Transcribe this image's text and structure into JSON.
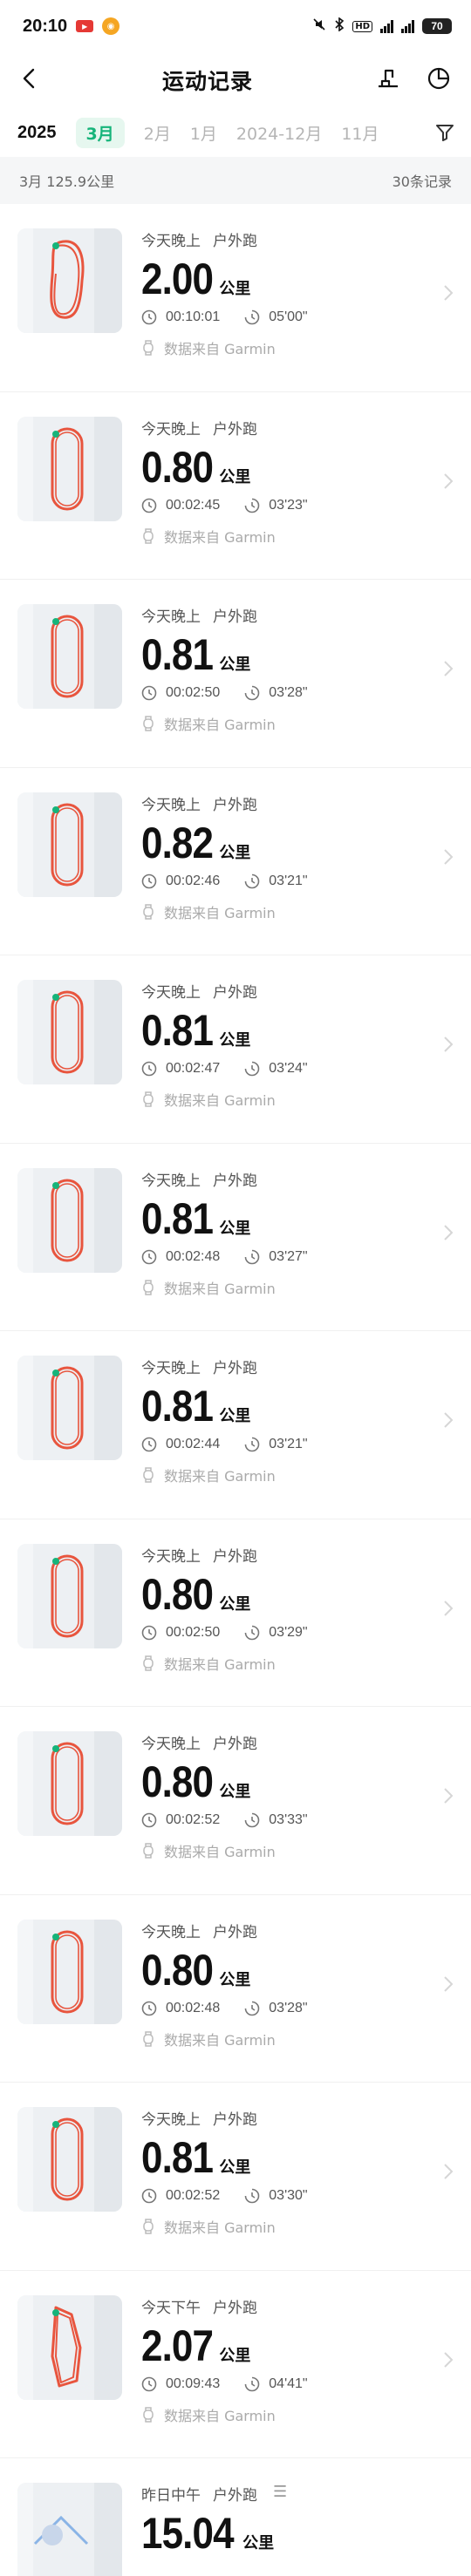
{
  "status": {
    "time": "20:10",
    "badge_app": "Video",
    "battery": "70"
  },
  "header": {
    "title": "运动记录"
  },
  "tabs": {
    "year": "2025",
    "items": [
      "3月",
      "2月",
      "1月",
      "2024-12月",
      "11月"
    ]
  },
  "summary": {
    "left": "3月  125.9公里",
    "right": "30条记录"
  },
  "unit": "公里",
  "records": [
    {
      "when": "今天晚上",
      "type": "户外跑",
      "distance": "2.00",
      "duration": "00:10:01",
      "pace": "05'00\"",
      "source": "数据来自 Garmin"
    },
    {
      "when": "今天晚上",
      "type": "户外跑",
      "distance": "0.80",
      "duration": "00:02:45",
      "pace": "03'23\"",
      "source": "数据来自 Garmin"
    },
    {
      "when": "今天晚上",
      "type": "户外跑",
      "distance": "0.81",
      "duration": "00:02:50",
      "pace": "03'28\"",
      "source": "数据来自 Garmin"
    },
    {
      "when": "今天晚上",
      "type": "户外跑",
      "distance": "0.82",
      "duration": "00:02:46",
      "pace": "03'21\"",
      "source": "数据来自 Garmin"
    },
    {
      "when": "今天晚上",
      "type": "户外跑",
      "distance": "0.81",
      "duration": "00:02:47",
      "pace": "03'24\"",
      "source": "数据来自 Garmin"
    },
    {
      "when": "今天晚上",
      "type": "户外跑",
      "distance": "0.81",
      "duration": "00:02:48",
      "pace": "03'27\"",
      "source": "数据来自 Garmin"
    },
    {
      "when": "今天晚上",
      "type": "户外跑",
      "distance": "0.81",
      "duration": "00:02:44",
      "pace": "03'21\"",
      "source": "数据来自 Garmin"
    },
    {
      "when": "今天晚上",
      "type": "户外跑",
      "distance": "0.80",
      "duration": "00:02:50",
      "pace": "03'29\"",
      "source": "数据来自 Garmin"
    },
    {
      "when": "今天晚上",
      "type": "户外跑",
      "distance": "0.80",
      "duration": "00:02:52",
      "pace": "03'33\"",
      "source": "数据来自 Garmin"
    },
    {
      "when": "今天晚上",
      "type": "户外跑",
      "distance": "0.80",
      "duration": "00:02:48",
      "pace": "03'28\"",
      "source": "数据来自 Garmin"
    },
    {
      "when": "今天晚上",
      "type": "户外跑",
      "distance": "0.81",
      "duration": "00:02:52",
      "pace": "03'30\"",
      "source": "数据来自 Garmin"
    },
    {
      "when": "今天下午",
      "type": "户外跑",
      "distance": "2.07",
      "duration": "00:09:43",
      "pace": "04'41\"",
      "source": "数据来自 Garmin"
    },
    {
      "when": "昨日中午",
      "type": "户外跑",
      "distance": "15.04",
      "duration": "",
      "pace": "",
      "source": ""
    }
  ],
  "colors": {
    "accent": "#16b47a",
    "route": "#e8553e",
    "route_start": "#16b47a"
  }
}
